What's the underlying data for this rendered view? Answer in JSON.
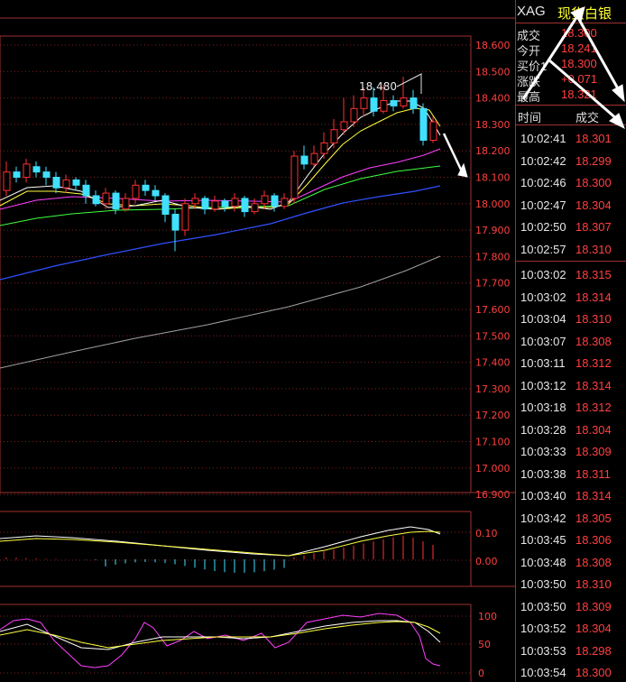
{
  "price_axis": [
    "18.600",
    "18.500",
    "18.400",
    "18.300",
    "18.200",
    "18.100",
    "18.000",
    "17.900",
    "17.800",
    "17.700",
    "17.600",
    "17.500",
    "17.400",
    "17.300",
    "17.200",
    "17.100",
    "17.000",
    "16.900"
  ],
  "macd_axis": [
    "0.10",
    "0.00"
  ],
  "kdj_axis": [
    "100",
    "50",
    "0"
  ],
  "peak_label": "18.480",
  "quote": {
    "symbol": "XAG",
    "name": "现货白银",
    "rows": [
      {
        "label": "成交",
        "value": "18.300"
      },
      {
        "label": "今开",
        "value": "18.241"
      },
      {
        "label": "买价1",
        "value": "18.300"
      },
      {
        "label": "涨跌",
        "value": "+0.071"
      },
      {
        "label": "最高",
        "value": "18.321"
      }
    ]
  },
  "ticks_header": {
    "time": "时间",
    "price": "成交"
  },
  "ticks": [
    {
      "time": "10:02:41",
      "price": "18.301"
    },
    {
      "time": "10:02:42",
      "price": "18.299"
    },
    {
      "time": "10:02:46",
      "price": "18.300"
    },
    {
      "time": "10:02:47",
      "price": "18.304"
    },
    {
      "time": "10:02:50",
      "price": "18.307"
    },
    {
      "time": "10:02:57",
      "price": "18.310"
    },
    {
      "time": "10:03:02",
      "price": "18.315"
    },
    {
      "time": "10:03:02",
      "price": "18.314"
    },
    {
      "time": "10:03:04",
      "price": "18.310"
    },
    {
      "time": "10:03:07",
      "price": "18.308"
    },
    {
      "time": "10:03:11",
      "price": "18.312"
    },
    {
      "time": "10:03:12",
      "price": "18.314"
    },
    {
      "time": "10:03:18",
      "price": "18.312"
    },
    {
      "time": "10:03:28",
      "price": "18.304"
    },
    {
      "time": "10:03:33",
      "price": "18.309"
    },
    {
      "time": "10:03:38",
      "price": "18.311"
    },
    {
      "time": "10:03:40",
      "price": "18.314"
    },
    {
      "time": "10:03:42",
      "price": "18.305"
    },
    {
      "time": "10:03:45",
      "price": "18.306"
    },
    {
      "time": "10:03:48",
      "price": "18.308"
    },
    {
      "time": "10:03:50",
      "price": "18.310"
    },
    {
      "time": "10:03:50",
      "price": "18.309"
    },
    {
      "time": "10:03:52",
      "price": "18.304"
    },
    {
      "time": "10:03:53",
      "price": "18.298"
    },
    {
      "time": "10:03:54",
      "price": "18.300"
    }
  ],
  "colors": {
    "up": "#ff3030",
    "down": "#40e0ff",
    "grid": "#a03030",
    "ma5": "#ffffff",
    "ma10": "#ffff40",
    "ma20": "#ff40ff",
    "ma30": "#40ff40",
    "ma60": "#4060ff",
    "ma120": "#a0a0a0"
  }
}
